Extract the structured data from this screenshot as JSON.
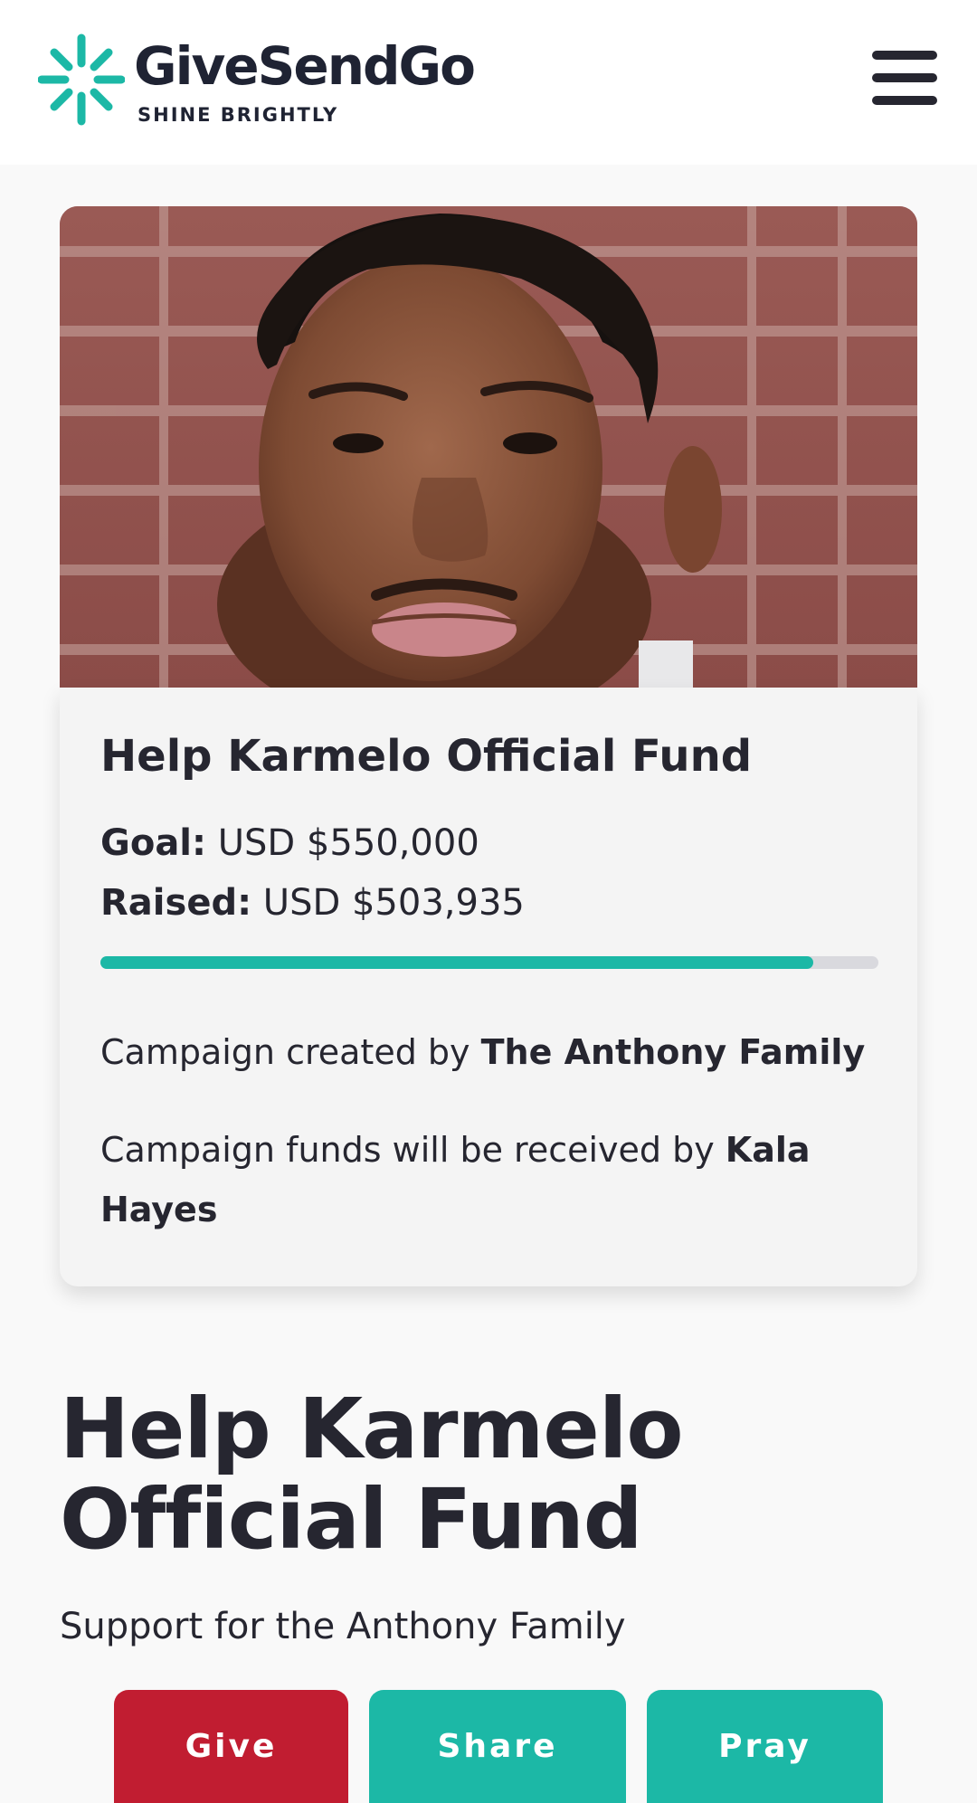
{
  "header": {
    "brand_name": "GiveSendGo",
    "tagline": "SHINE BRIGHTLY",
    "brand_color": "#1cb8a6",
    "menu_icon": "hamburger-icon"
  },
  "hero": {
    "photo": "portrait of young man in front of brick wall"
  },
  "campaign": {
    "title": "Help Karmelo Official Fund",
    "goal_label": "Goal:",
    "goal_value": "USD $550,000",
    "raised_label": "Raised:",
    "raised_value": "USD $503,935",
    "progress_fraction": 0.916,
    "created_by_text": "Campaign created by ",
    "created_by_name": "The Anthony Family",
    "recipient_text": "Campaign funds will be received by ",
    "recipient_name": "Kala Hayes"
  },
  "main": {
    "title": "Help Karmelo Official Fund",
    "subtitle": "Support for the Anthony Family"
  },
  "actions": {
    "give_label": "Give",
    "share_label": "Share",
    "pray_label": "Pray",
    "give_color": "#c11d31",
    "share_color": "#1cb8a6",
    "pray_color": "#1cb8a6"
  }
}
